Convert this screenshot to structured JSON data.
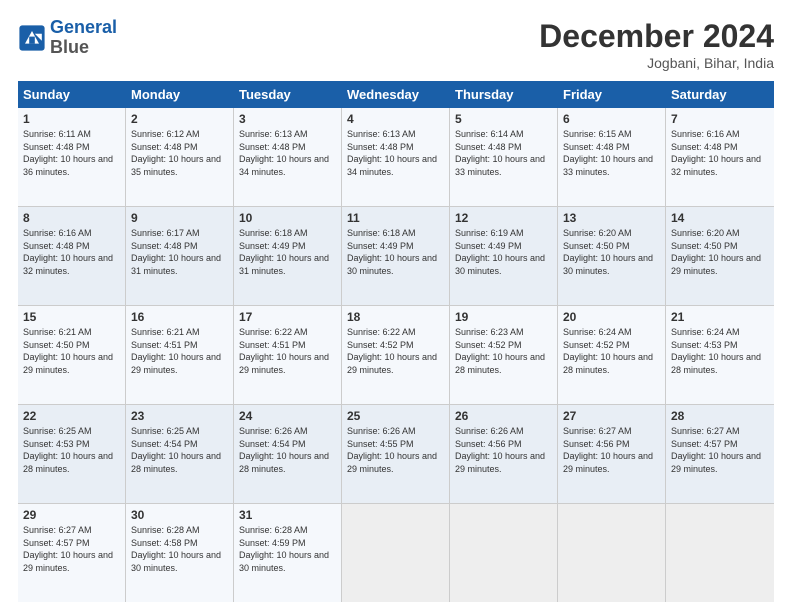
{
  "logo": {
    "line1": "General",
    "line2": "Blue"
  },
  "title": "December 2024",
  "subtitle": "Jogbani, Bihar, India",
  "days": [
    "Sunday",
    "Monday",
    "Tuesday",
    "Wednesday",
    "Thursday",
    "Friday",
    "Saturday"
  ],
  "weeks": [
    [
      {
        "day": 1,
        "sunrise": "6:11 AM",
        "sunset": "4:48 PM",
        "daylight": "10 hours and 36 minutes."
      },
      {
        "day": 2,
        "sunrise": "6:12 AM",
        "sunset": "4:48 PM",
        "daylight": "10 hours and 35 minutes."
      },
      {
        "day": 3,
        "sunrise": "6:13 AM",
        "sunset": "4:48 PM",
        "daylight": "10 hours and 34 minutes."
      },
      {
        "day": 4,
        "sunrise": "6:13 AM",
        "sunset": "4:48 PM",
        "daylight": "10 hours and 34 minutes."
      },
      {
        "day": 5,
        "sunrise": "6:14 AM",
        "sunset": "4:48 PM",
        "daylight": "10 hours and 33 minutes."
      },
      {
        "day": 6,
        "sunrise": "6:15 AM",
        "sunset": "4:48 PM",
        "daylight": "10 hours and 33 minutes."
      },
      {
        "day": 7,
        "sunrise": "6:16 AM",
        "sunset": "4:48 PM",
        "daylight": "10 hours and 32 minutes."
      }
    ],
    [
      {
        "day": 8,
        "sunrise": "6:16 AM",
        "sunset": "4:48 PM",
        "daylight": "10 hours and 32 minutes."
      },
      {
        "day": 9,
        "sunrise": "6:17 AM",
        "sunset": "4:48 PM",
        "daylight": "10 hours and 31 minutes."
      },
      {
        "day": 10,
        "sunrise": "6:18 AM",
        "sunset": "4:49 PM",
        "daylight": "10 hours and 31 minutes."
      },
      {
        "day": 11,
        "sunrise": "6:18 AM",
        "sunset": "4:49 PM",
        "daylight": "10 hours and 30 minutes."
      },
      {
        "day": 12,
        "sunrise": "6:19 AM",
        "sunset": "4:49 PM",
        "daylight": "10 hours and 30 minutes."
      },
      {
        "day": 13,
        "sunrise": "6:20 AM",
        "sunset": "4:50 PM",
        "daylight": "10 hours and 30 minutes."
      },
      {
        "day": 14,
        "sunrise": "6:20 AM",
        "sunset": "4:50 PM",
        "daylight": "10 hours and 29 minutes."
      }
    ],
    [
      {
        "day": 15,
        "sunrise": "6:21 AM",
        "sunset": "4:50 PM",
        "daylight": "10 hours and 29 minutes."
      },
      {
        "day": 16,
        "sunrise": "6:21 AM",
        "sunset": "4:51 PM",
        "daylight": "10 hours and 29 minutes."
      },
      {
        "day": 17,
        "sunrise": "6:22 AM",
        "sunset": "4:51 PM",
        "daylight": "10 hours and 29 minutes."
      },
      {
        "day": 18,
        "sunrise": "6:22 AM",
        "sunset": "4:52 PM",
        "daylight": "10 hours and 29 minutes."
      },
      {
        "day": 19,
        "sunrise": "6:23 AM",
        "sunset": "4:52 PM",
        "daylight": "10 hours and 28 minutes."
      },
      {
        "day": 20,
        "sunrise": "6:24 AM",
        "sunset": "4:52 PM",
        "daylight": "10 hours and 28 minutes."
      },
      {
        "day": 21,
        "sunrise": "6:24 AM",
        "sunset": "4:53 PM",
        "daylight": "10 hours and 28 minutes."
      }
    ],
    [
      {
        "day": 22,
        "sunrise": "6:25 AM",
        "sunset": "4:53 PM",
        "daylight": "10 hours and 28 minutes."
      },
      {
        "day": 23,
        "sunrise": "6:25 AM",
        "sunset": "4:54 PM",
        "daylight": "10 hours and 28 minutes."
      },
      {
        "day": 24,
        "sunrise": "6:26 AM",
        "sunset": "4:54 PM",
        "daylight": "10 hours and 28 minutes."
      },
      {
        "day": 25,
        "sunrise": "6:26 AM",
        "sunset": "4:55 PM",
        "daylight": "10 hours and 29 minutes."
      },
      {
        "day": 26,
        "sunrise": "6:26 AM",
        "sunset": "4:56 PM",
        "daylight": "10 hours and 29 minutes."
      },
      {
        "day": 27,
        "sunrise": "6:27 AM",
        "sunset": "4:56 PM",
        "daylight": "10 hours and 29 minutes."
      },
      {
        "day": 28,
        "sunrise": "6:27 AM",
        "sunset": "4:57 PM",
        "daylight": "10 hours and 29 minutes."
      }
    ],
    [
      {
        "day": 29,
        "sunrise": "6:27 AM",
        "sunset": "4:57 PM",
        "daylight": "10 hours and 29 minutes."
      },
      {
        "day": 30,
        "sunrise": "6:28 AM",
        "sunset": "4:58 PM",
        "daylight": "10 hours and 30 minutes."
      },
      {
        "day": 31,
        "sunrise": "6:28 AM",
        "sunset": "4:59 PM",
        "daylight": "10 hours and 30 minutes."
      },
      null,
      null,
      null,
      null
    ]
  ]
}
